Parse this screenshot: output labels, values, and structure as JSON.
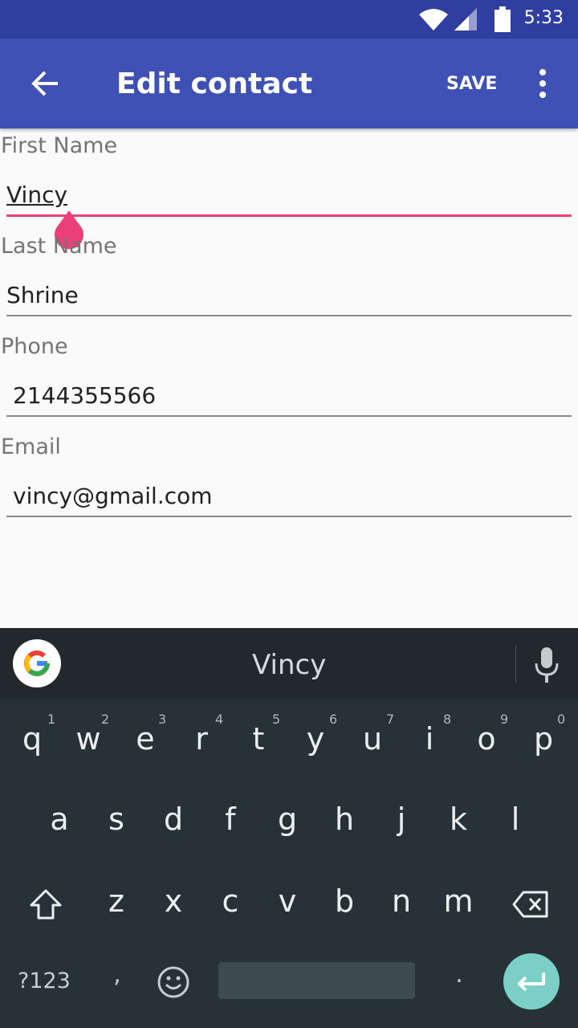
{
  "status": {
    "time": "5:33"
  },
  "toolbar": {
    "title": "Edit contact",
    "save_label": "SAVE"
  },
  "form": {
    "first_name": {
      "label": "First Name",
      "value": "Vincy"
    },
    "last_name": {
      "label": "Last Name",
      "value": "Shrine"
    },
    "phone": {
      "label": "Phone",
      "value": "2144355566"
    },
    "email": {
      "label": "Email",
      "value": "vincy@gmail.com"
    }
  },
  "keyboard": {
    "suggestion": "Vincy",
    "row1": [
      "q",
      "w",
      "e",
      "r",
      "t",
      "y",
      "u",
      "i",
      "o",
      "p"
    ],
    "row1_hints": [
      "1",
      "2",
      "3",
      "4",
      "5",
      "6",
      "7",
      "8",
      "9",
      "0"
    ],
    "row2": [
      "a",
      "s",
      "d",
      "f",
      "g",
      "h",
      "j",
      "k",
      "l"
    ],
    "row3": [
      "z",
      "x",
      "c",
      "v",
      "b",
      "n",
      "m"
    ],
    "symbols_label": "?123",
    "comma": ",",
    "period": "."
  },
  "colors": {
    "primary": "#3f51b5",
    "primary_dark": "#303f9f",
    "accent": "#ec407a",
    "keyboard_bg": "#263238",
    "enter_key": "#7ccfc7"
  }
}
